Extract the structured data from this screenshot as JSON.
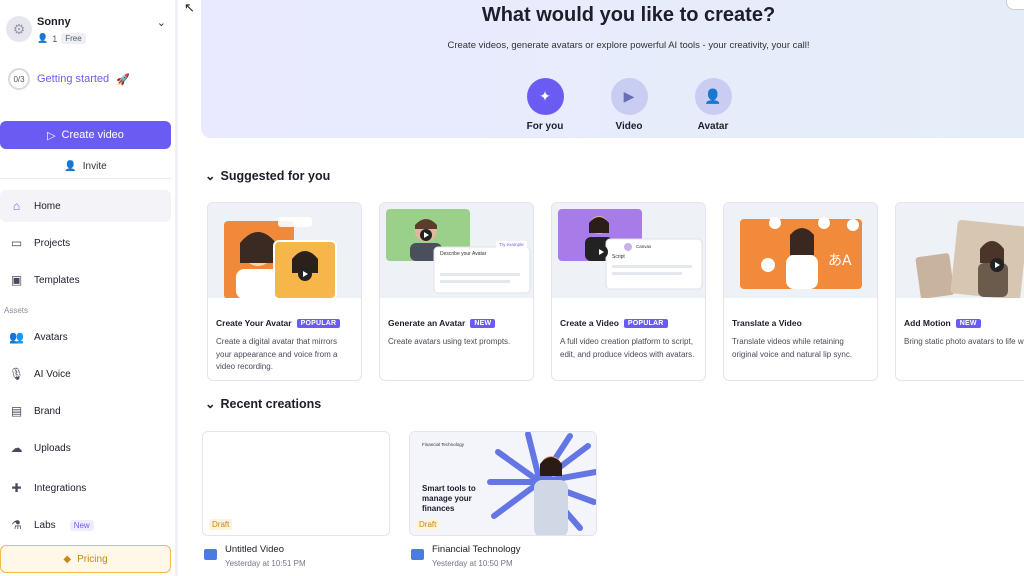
{
  "sidebar": {
    "workspace": {
      "name": "Sonny",
      "members": "1",
      "plan": "Free"
    },
    "getting_started": {
      "progress": "0/3",
      "label": "Getting started"
    },
    "create_video": "Create video",
    "invite": "Invite",
    "nav": [
      {
        "label": "Home",
        "icon": "home-icon",
        "active": true
      },
      {
        "label": "Projects",
        "icon": "folder-icon"
      },
      {
        "label": "Templates",
        "icon": "templates-icon"
      }
    ],
    "assets_label": "Assets",
    "assets": [
      {
        "label": "Avatars",
        "icon": "avatar-icon"
      },
      {
        "label": "AI Voice",
        "icon": "voice-icon"
      },
      {
        "label": "Brand",
        "icon": "brand-icon"
      },
      {
        "label": "Uploads",
        "icon": "upload-icon"
      },
      {
        "label": "Integrations",
        "icon": "puzzle-icon"
      },
      {
        "label": "Labs",
        "icon": "flask-icon",
        "badge": "New"
      }
    ],
    "pricing": "Pricing"
  },
  "hero": {
    "title": "What would you like to create?",
    "subtitle": "Create videos, generate avatars or explore powerful AI tools - your creativity, your call!",
    "options": [
      {
        "label": "For you",
        "icon": "magic-wand-icon",
        "active": true
      },
      {
        "label": "Video",
        "icon": "video-icon"
      },
      {
        "label": "Avatar",
        "icon": "add-user-icon"
      }
    ]
  },
  "suggested": {
    "title": "Suggested for you",
    "cards": [
      {
        "title": "Create Your Avatar",
        "tag": "POPULAR",
        "desc": "Create a digital avatar that mirrors your appearance and voice from a video recording.",
        "thumb": "create-avatar-thumb"
      },
      {
        "title": "Generate an Avatar",
        "tag": "NEW",
        "desc": "Create avatars using text prompts.",
        "thumb": "generate-avatar-thumb",
        "thumb_text": "Describe your Avatar",
        "thumb_chip": "Try example"
      },
      {
        "title": "Create a Video",
        "tag": "POPULAR",
        "desc": "A full video creation platform to script, edit, and produce videos with avatars.",
        "thumb": "create-video-thumb",
        "thumb_text": "Script",
        "thumb_chip": "Canvas"
      },
      {
        "title": "Translate a Video",
        "tag": "",
        "desc": "Translate videos while retaining original voice and natural lip sync.",
        "thumb": "translate-video-thumb"
      },
      {
        "title": "Add Motion",
        "tag": "NEW",
        "desc": "Bring static photo avatars to life with realistic, lifelike motion.",
        "thumb": "add-motion-thumb"
      }
    ]
  },
  "recent": {
    "title": "Recent creations",
    "items": [
      {
        "title": "Untitled Video",
        "time": "Yesterday at 10:51 PM",
        "badge": "Draft",
        "thumb": "blank"
      },
      {
        "title": "Financial Technology",
        "time": "Yesterday at 10:50 PM",
        "badge": "Draft",
        "thumb": "finance",
        "thumb_header": "Financial Technology",
        "thumb_text": "Smart tools to manage your finances"
      }
    ]
  },
  "colors": {
    "accent": "#6a5cf2",
    "pricing": "#f0b94b",
    "hero_bg": "#e8ebfc"
  }
}
